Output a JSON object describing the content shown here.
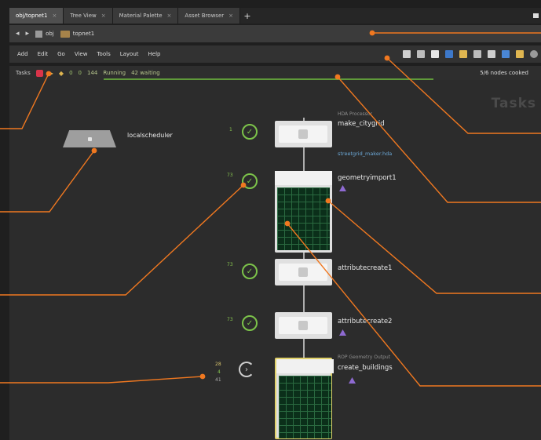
{
  "tabs": [
    {
      "label": "obj/topnet1"
    },
    {
      "label": "Tree View"
    },
    {
      "label": "Material Palette"
    },
    {
      "label": "Asset Browser"
    }
  ],
  "path": {
    "context": "obj",
    "node": "topnet1"
  },
  "menu": [
    "Add",
    "Edit",
    "Go",
    "View",
    "Tools",
    "Layout",
    "Help"
  ],
  "tasks_bar": {
    "label": "Tasks",
    "a": "0",
    "b": "0",
    "c": "144",
    "running": "Running",
    "waiting": "42 waiting",
    "cooked": "5/6 nodes cooked"
  },
  "watermark": "Tasks",
  "scheduler": {
    "label": "localscheduler"
  },
  "nodes": [
    {
      "name": "make_citygrid",
      "sub": "HDA Processor",
      "link": "streetgrid_maker.hda",
      "count": "1"
    },
    {
      "name": "geometryimport1",
      "sub": "",
      "count": "73"
    },
    {
      "name": "attributecreate1",
      "count": "73"
    },
    {
      "name": "attributecreate2",
      "count": "73"
    },
    {
      "name": "create_buildings",
      "sub": "ROP Geometry Output",
      "count_a": "28",
      "count_b": "4",
      "count_c": "41"
    }
  ],
  "colors": {
    "accent_orange": "#f07820",
    "success": "#7cc34a",
    "warning": "#8e6ad1",
    "selected": "#e1d16a"
  }
}
